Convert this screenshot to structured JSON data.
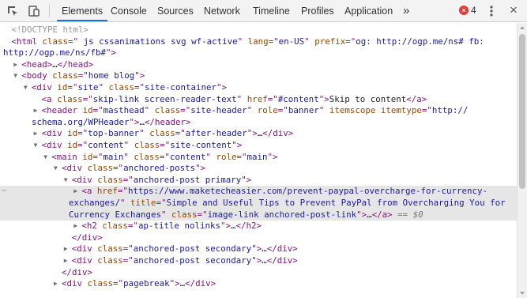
{
  "toolbar": {
    "tabs": [
      "Elements",
      "Console",
      "Sources",
      "Network",
      "Timeline",
      "Profiles",
      "Application"
    ],
    "active_tab": "Elements",
    "overflow": "»",
    "error_count": "4",
    "accent_color": "#1a73e8",
    "error_color": "#e53935"
  },
  "tree": {
    "lines": [
      {
        "indent": 0,
        "toggle": "",
        "html": "<span class=\"doctype\">&lt;!DOCTYPE html&gt;</span>"
      },
      {
        "indent": 0,
        "toggle": "",
        "html": "<span class=\"tag\">&lt;html</span> <span class=\"attr\">class</span><span class=\"tag\">=\"</span><span class=\"val\"> js cssanimations svg wf-active</span><span class=\"tag\">\"</span> <span class=\"attr\">lang</span><span class=\"tag\">=\"</span><span class=\"val\">en-US</span><span class=\"tag\">\"</span> <span class=\"attr\">prefix</span><span class=\"tag\">=\"</span><span class=\"val\">og: http://ogp.me/ns# fb:</span>"
      },
      {
        "indent": -1,
        "toggle": "",
        "html": "<span class=\"val\">http://ogp.me/ns/fb#</span><span class=\"tag\">\"&gt;</span>"
      },
      {
        "indent": 1,
        "toggle": "right",
        "html": "<span class=\"tag\">&lt;head&gt;</span><span class=\"ell\">…</span><span class=\"tag\">&lt;/head&gt;</span>"
      },
      {
        "indent": 1,
        "toggle": "down",
        "html": "<span class=\"tag\">&lt;body</span> <span class=\"attr\">class</span><span class=\"tag\">=\"</span><span class=\"val\">home blog</span><span class=\"tag\">\"&gt;</span>"
      },
      {
        "indent": 2,
        "toggle": "down",
        "html": "<span class=\"tag\">&lt;div</span> <span class=\"attr\">id</span><span class=\"tag\">=\"</span><span class=\"val\">site</span><span class=\"tag\">\"</span> <span class=\"attr\">class</span><span class=\"tag\">=\"</span><span class=\"val\">site-container</span><span class=\"tag\">\"&gt;</span>"
      },
      {
        "indent": 3,
        "toggle": "",
        "html": "<span class=\"tag\">&lt;a</span> <span class=\"attr\">class</span><span class=\"tag\">=\"</span><span class=\"val\">skip-link screen-reader-text</span><span class=\"tag\">\"</span> <span class=\"attr\">href</span><span class=\"tag\">=\"</span><span class=\"val\">#content</span><span class=\"tag\">\"&gt;</span><span class=\"txt\">Skip to content</span><span class=\"tag\">&lt;/a&gt;</span>"
      },
      {
        "indent": 3,
        "toggle": "right",
        "html": "<span class=\"tag\">&lt;header</span> <span class=\"attr\">id</span><span class=\"tag\">=\"</span><span class=\"val\">masthead</span><span class=\"tag\">\"</span> <span class=\"attr\">class</span><span class=\"tag\">=\"</span><span class=\"val\">site-header</span><span class=\"tag\">\"</span> <span class=\"attr\">role</span><span class=\"tag\">=\"</span><span class=\"val\">banner</span><span class=\"tag\">\"</span> <span class=\"attr\">itemscope itemtype</span><span class=\"tag\">=\"</span><span class=\"val\">http://</span>"
      },
      {
        "indent": -2,
        "toggle": "",
        "html": "<span class=\"val\">schema.org/WPHeader</span><span class=\"tag\">\"&gt;</span><span class=\"ell\">…</span><span class=\"tag\">&lt;/header&gt;</span>"
      },
      {
        "indent": 3,
        "toggle": "right",
        "html": "<span class=\"tag\">&lt;div</span> <span class=\"attr\">id</span><span class=\"tag\">=\"</span><span class=\"val\">top-banner</span><span class=\"tag\">\"</span> <span class=\"attr\">class</span><span class=\"tag\">=\"</span><span class=\"val\">after-header</span><span class=\"tag\">\"&gt;</span><span class=\"ell\">…</span><span class=\"tag\">&lt;/div&gt;</span>"
      },
      {
        "indent": 3,
        "toggle": "down",
        "html": "<span class=\"tag\">&lt;div</span> <span class=\"attr\">id</span><span class=\"tag\">=\"</span><span class=\"val\">content</span><span class=\"tag\">\"</span> <span class=\"attr\">class</span><span class=\"tag\">=\"</span><span class=\"val\">site-content</span><span class=\"tag\">\"&gt;</span>"
      },
      {
        "indent": 4,
        "toggle": "down",
        "html": "<span class=\"tag\">&lt;main</span> <span class=\"attr\">id</span><span class=\"tag\">=\"</span><span class=\"val\">main</span><span class=\"tag\">\"</span> <span class=\"attr\">class</span><span class=\"tag\">=\"</span><span class=\"val\">content</span><span class=\"tag\">\"</span> <span class=\"attr\">role</span><span class=\"tag\">=\"</span><span class=\"val\">main</span><span class=\"tag\">\"&gt;</span>"
      },
      {
        "indent": 5,
        "toggle": "down",
        "html": "<span class=\"tag\">&lt;div</span> <span class=\"attr\">class</span><span class=\"tag\">=\"</span><span class=\"val\">anchored-posts</span><span class=\"tag\">\"&gt;</span>"
      },
      {
        "indent": 6,
        "toggle": "down",
        "html": "<span class=\"tag\">&lt;div</span> <span class=\"attr\">class</span><span class=\"tag\">=\"</span><span class=\"val\">anchored-post primary</span><span class=\"tag\">\"&gt;</span>"
      },
      {
        "indent": 7,
        "toggle": "right",
        "hl": true,
        "dots": true,
        "html": "<span class=\"tag\">&lt;a</span> <span class=\"attr\">href</span><span class=\"tag\">=\"</span><span class=\"val\">https://www.maketecheasier.com/prevent-paypal-overcharge-for-currency-</span>"
      },
      {
        "indent": -3,
        "toggle": "",
        "hl": true,
        "html": "<span class=\"val\">exchanges/</span><span class=\"tag\">\"</span> <span class=\"attr\">title</span><span class=\"tag\">=\"</span><span class=\"val\">Simple and Useful Tips to Prevent PayPal from Overcharging You for</span>"
      },
      {
        "indent": -3,
        "toggle": "",
        "hl": true,
        "html": "<span class=\"val\">Currency Exchanges</span><span class=\"tag\">\"</span> <span class=\"attr\">class</span><span class=\"tag\">=\"</span><span class=\"val\">image-link anchored-post-link</span><span class=\"tag\">\"&gt;</span><span class=\"ell\">…</span><span class=\"tag\">&lt;/a&gt;</span> <span class=\"dollar\">== $0</span>"
      },
      {
        "indent": 7,
        "toggle": "right",
        "html": "<span class=\"tag\">&lt;h2</span> <span class=\"attr\">class</span><span class=\"tag\">=\"</span><span class=\"val\">ap-title nolinks</span><span class=\"tag\">\"&gt;</span><span class=\"ell\">…</span><span class=\"tag\">&lt;/h2&gt;</span>"
      },
      {
        "indent": 6,
        "toggle": "",
        "html": "<span class=\"tag\">&lt;/div&gt;</span>"
      },
      {
        "indent": 6,
        "toggle": "right",
        "html": "<span class=\"tag\">&lt;div</span> <span class=\"attr\">class</span><span class=\"tag\">=\"</span><span class=\"val\">anchored-post secondary</span><span class=\"tag\">\"&gt;</span><span class=\"ell\">…</span><span class=\"tag\">&lt;/div&gt;</span>"
      },
      {
        "indent": 6,
        "toggle": "right",
        "html": "<span class=\"tag\">&lt;div</span> <span class=\"attr\">class</span><span class=\"tag\">=\"</span><span class=\"val\">anchored-post secondary</span><span class=\"tag\">\"&gt;</span><span class=\"ell\">…</span><span class=\"tag\">&lt;/div&gt;</span>"
      },
      {
        "indent": 5,
        "toggle": "",
        "html": "<span class=\"tag\">&lt;/div&gt;</span>"
      },
      {
        "indent": 5,
        "toggle": "right",
        "html": "<span class=\"tag\">&lt;div</span> <span class=\"attr\">class</span><span class=\"tag\">=\"</span><span class=\"val\">pagebreak</span><span class=\"tag\">\"&gt;</span><span class=\"ell\">…</span><span class=\"tag\">&lt;/div&gt;</span>"
      }
    ]
  }
}
